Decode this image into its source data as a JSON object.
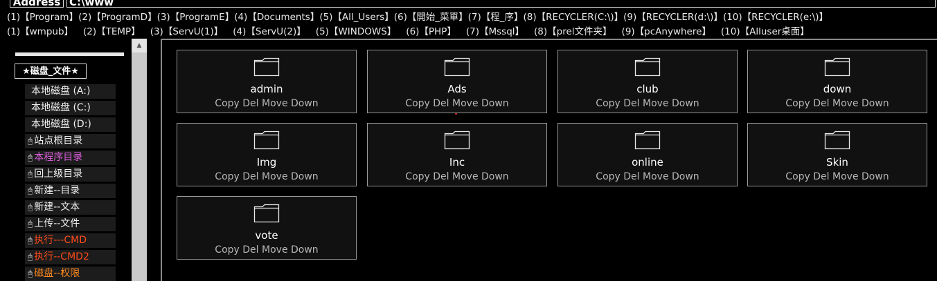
{
  "address": {
    "label": "Address",
    "value": "C:\\www"
  },
  "quick_links_row1": [
    "(1)【Program】",
    "(2)【ProgramD】",
    "(3)【ProgramE】",
    "(4)【Documents】",
    "(5)【All_Users】",
    "(6)【開始_菜單】",
    "(7)【程_序】",
    "(8)【RECYCLER(C:\\)】",
    "(9)【RECYCLER(d:\\)】",
    "(10)【RECYCLER(e:\\)】"
  ],
  "quick_links_row2": [
    "(1)【wmpub】",
    "(2)【TEMP】",
    "(3)【ServU(1)】",
    "(4)【ServU(2)】",
    "(5)【WINDOWS】",
    "(6)【PHP】",
    "(7)【Mssql】",
    "(8)【prel文件夹】",
    "(9)【pcAnywhere】",
    "(10)【Alluser桌面】"
  ],
  "sidebar": {
    "title": "★磁盘_文件★",
    "disks": [
      "本地磁盘 (A:)",
      "本地磁盘 (C:)",
      "本地磁盘 (D:)"
    ],
    "actions": [
      {
        "label": "站点根目录",
        "color": "#f0f0f0"
      },
      {
        "label": "本程序目录",
        "color": "#e060e0"
      },
      {
        "label": "回上级目录",
        "color": "#f0f0f0"
      },
      {
        "label": "新建--目录",
        "color": "#f0f0f0"
      },
      {
        "label": "新建--文本",
        "color": "#f0f0f0"
      },
      {
        "label": "上传--文件",
        "color": "#f0f0f0"
      },
      {
        "label": "执行---CMD",
        "color": "#ff4a1a"
      },
      {
        "label": "执行--CMD2",
        "color": "#ff4a1a"
      },
      {
        "label": "磁盘--权限",
        "color": "#ff8a20"
      }
    ]
  },
  "folder_actions": [
    "Copy",
    "Del",
    "Move",
    "Down"
  ],
  "folders": [
    "admin",
    "Ads",
    "club",
    "down",
    "Img",
    "Inc",
    "online",
    "Skin",
    "vote"
  ]
}
